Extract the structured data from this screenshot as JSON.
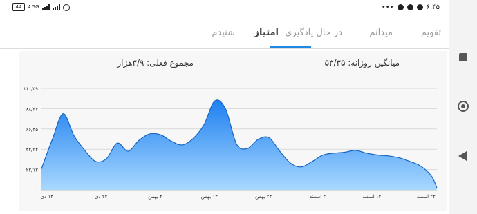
{
  "status_bar": {
    "battery": "44",
    "network": "4.5G",
    "time": "۶:۴۵",
    "dots": "•••"
  },
  "tabs": [
    {
      "label": "تقویم",
      "active": false
    },
    {
      "label": "میدانم",
      "active": false
    },
    {
      "label": "در حال یادگیری",
      "active": false
    },
    {
      "label": "امتیاز",
      "active": true
    },
    {
      "label": "شنیدم",
      "active": false
    }
  ],
  "summary": {
    "daily_average": "میانگین روزانه: ۵۳/۳۵",
    "current_total": "مجموع فعلی: ۳/۹هزار"
  },
  "colors": {
    "accent": "#1e88e5",
    "line": "#1565c0",
    "fill_top": "#1e80f0",
    "fill_bottom": "#a8d8ff"
  },
  "chart_data": {
    "type": "area",
    "title": "",
    "xlabel": "",
    "ylabel": "",
    "ylim": [
      0,
      110.59
    ],
    "y_tick_labels": [
      "۰",
      "۲۲/۱۲",
      "۴۴/۲۴",
      "۶۶/۳۵",
      "۸۸/۴۷",
      "۱۱۰/۵۹"
    ],
    "x_tick_labels": [
      "۱۴ دی",
      "۲۴ دی",
      "۴ بهمن",
      "۱۴ بهمن",
      "۲۴ بهمن",
      "۴ اسفند",
      "۱۴ اسفند",
      "۲۴ اسفند"
    ],
    "x_tick_positions": [
      1,
      11,
      21,
      31,
      41,
      51,
      61,
      71
    ],
    "x": [
      0,
      2,
      4,
      6,
      8,
      10,
      12,
      14,
      16,
      18,
      20,
      22,
      24,
      26,
      28,
      30,
      32,
      34,
      36,
      38,
      40,
      42,
      44,
      46,
      48,
      50,
      52,
      54,
      56,
      58,
      60,
      62,
      64,
      66,
      68,
      70,
      72,
      73
    ],
    "values": [
      23,
      55,
      83,
      59,
      43,
      31,
      34,
      51,
      42,
      54,
      61,
      60,
      53,
      49,
      56,
      71,
      97,
      88,
      50,
      45,
      55,
      57,
      42,
      29,
      25,
      31,
      38,
      40,
      41,
      43,
      40,
      38,
      37,
      35,
      31,
      26,
      15,
      2
    ]
  }
}
